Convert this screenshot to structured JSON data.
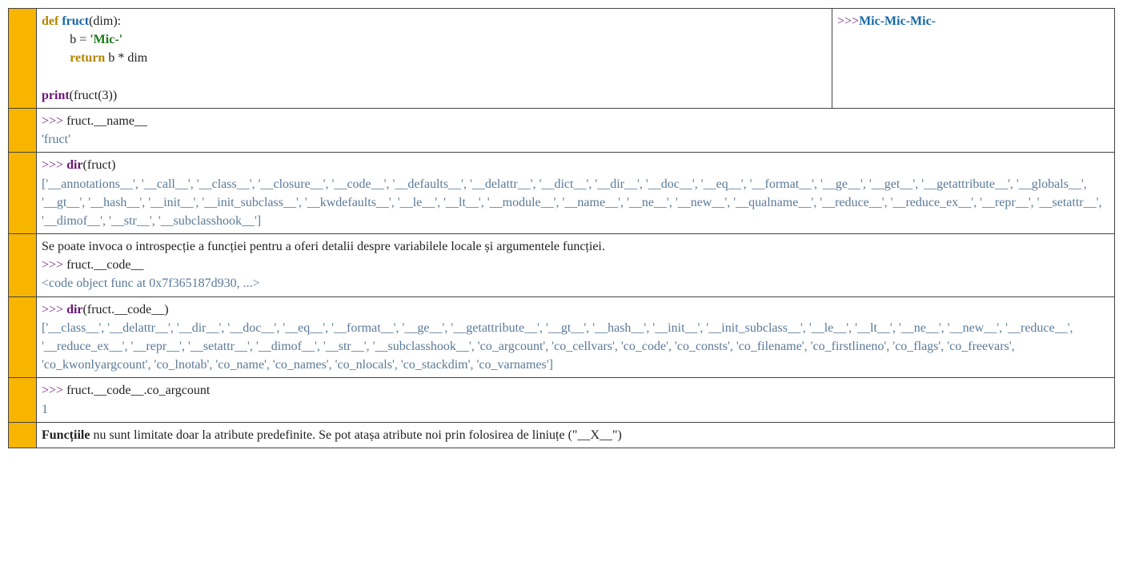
{
  "row1": {
    "code": {
      "def": "def",
      "fname": "fruct",
      "params": "(dim):",
      "assign_lhs": "b = ",
      "str_literal": "'Mic-'",
      "ret_kw": "return",
      "ret_expr": " b * dim",
      "print_kw": "print",
      "print_args": "(fruct(3))"
    },
    "out_prompt": ">>>",
    "out_value": "Mic-Mic-Mic-"
  },
  "row2": {
    "prompt": ">>> ",
    "expr": "fruct.__name__",
    "out": "'fruct'"
  },
  "row3": {
    "prompt": ">>> ",
    "dir_kw": "dir",
    "dir_args": "(fruct)",
    "out": "['__annotations__', '__call__', '__class__', '__closure__', '__code__', '__defaults__', '__delattr__', '__dict__', '__dir__', '__doc__', '__eq__', '__format__', '__ge__', '__get__', '__getattribute__', '__globals__', '__gt__', '__hash__', '__init__', '__init_subclass__', '__kwdefaults__', '__le__', '__lt__', '__module__', '__name__', '__ne__', '__new__', '__qualname__', '__reduce__', '__reduce_ex__', '__repr__', '__setattr__', '__dimof__', '__str__', '__subclasshook__']"
  },
  "row4": {
    "text": "Se poate invoca o introspecție a funcției pentru a oferi detalii despre variabilele locale și argumentele funcției.",
    "prompt": ">>> ",
    "expr": "fruct.__code__",
    "out": "<code object func at 0x7f365187d930, ...>"
  },
  "row5": {
    "prompt": ">>> ",
    "dir_kw": "dir",
    "dir_args": "(fruct.__code__)",
    "out": "['__class__', '__delattr__', '__dir__', '__doc__', '__eq__', '__format__', '__ge__', '__getattribute__', '__gt__', '__hash__', '__init__', '__init_subclass__', '__le__', '__lt__', '__ne__', '__new__', '__reduce__', '__reduce_ex__', '__repr__', '__setattr__', '__dimof__', '__str__', '__subclasshook__', 'co_argcount', 'co_cellvars', 'co_code', 'co_consts', 'co_filename', 'co_firstlineno', 'co_flags', 'co_freevars', 'co_kwonlyargcount', 'co_lnotab', 'co_name', 'co_names', 'co_nlocals', 'co_stackdim', 'co_varnames']"
  },
  "row6": {
    "prompt": ">>> ",
    "expr": "fruct.__code__.co_argcount",
    "out": "1"
  },
  "row7": {
    "bold": "Funcțiile",
    "rest": " nu sunt limitate doar la atribute predefinite. Se pot atașa atribute noi prin folosirea de liniuțe (\"__X__\")"
  }
}
